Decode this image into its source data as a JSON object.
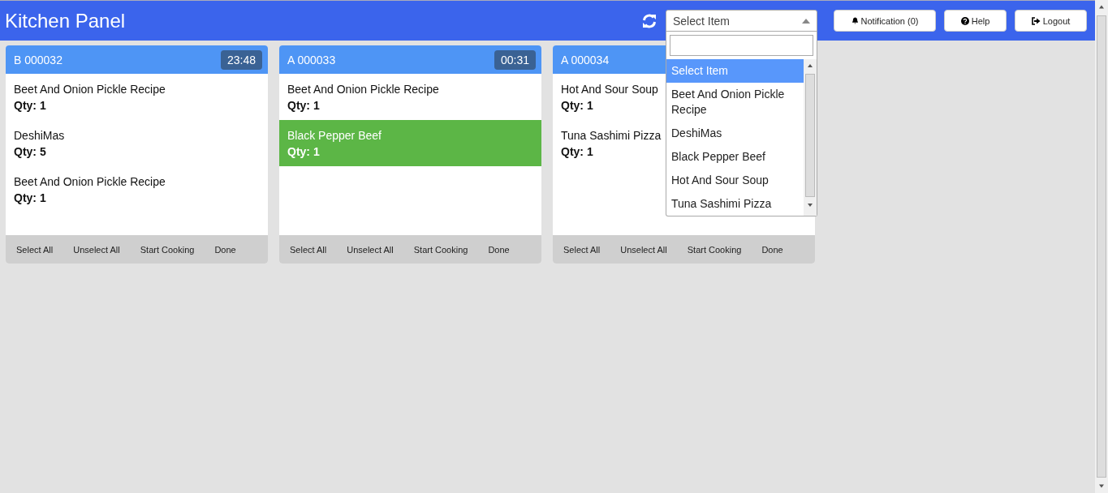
{
  "header": {
    "title": "Kitchen Panel",
    "select": {
      "value": "Select Item",
      "options": [
        {
          "label": "Select Item",
          "selected": true
        },
        {
          "label": "Beet And Onion Pickle Recipe",
          "selected": false
        },
        {
          "label": "DeshiMas",
          "selected": false
        },
        {
          "label": "Black Pepper Beef",
          "selected": false
        },
        {
          "label": "Hot And Sour Soup",
          "selected": false
        },
        {
          "label": "Tuna Sashimi Pizza",
          "selected": false
        }
      ]
    },
    "buttons": [
      {
        "kind": "bell",
        "label": "Notification (0)"
      },
      {
        "kind": "help",
        "label": "Help"
      },
      {
        "kind": "logout",
        "label": "Logout"
      }
    ]
  },
  "orders": [
    {
      "number": "B 000032",
      "timer": "23:48",
      "items": [
        {
          "name": "Beet And Onion Pickle Recipe",
          "qty": "Qty: 1",
          "selected": false
        },
        {
          "name": "DeshiMas",
          "qty": "Qty: 5",
          "selected": false
        },
        {
          "name": "Beet And Onion Pickle Recipe",
          "qty": "Qty: 1",
          "selected": false
        }
      ],
      "actions": [
        "Select All",
        "Unselect All",
        "Start Cooking",
        "Done"
      ]
    },
    {
      "number": "A 000033",
      "timer": "00:31",
      "items": [
        {
          "name": "Beet And Onion Pickle Recipe",
          "qty": "Qty: 1",
          "selected": false
        },
        {
          "name": "Black Pepper Beef",
          "qty": "Qty: 1",
          "selected": true
        }
      ],
      "actions": [
        "Select All",
        "Unselect All",
        "Start Cooking",
        "Done"
      ]
    },
    {
      "number": "A 000034",
      "items": [
        {
          "name": "Hot And Sour Soup",
          "qty": "Qty: 1",
          "selected": false
        },
        {
          "name": "Tuna Sashimi Pizza",
          "qty": "Qty: 1",
          "selected": false
        }
      ],
      "actions": [
        "Select All",
        "Unselect All",
        "Start Cooking",
        "Done"
      ]
    }
  ]
}
